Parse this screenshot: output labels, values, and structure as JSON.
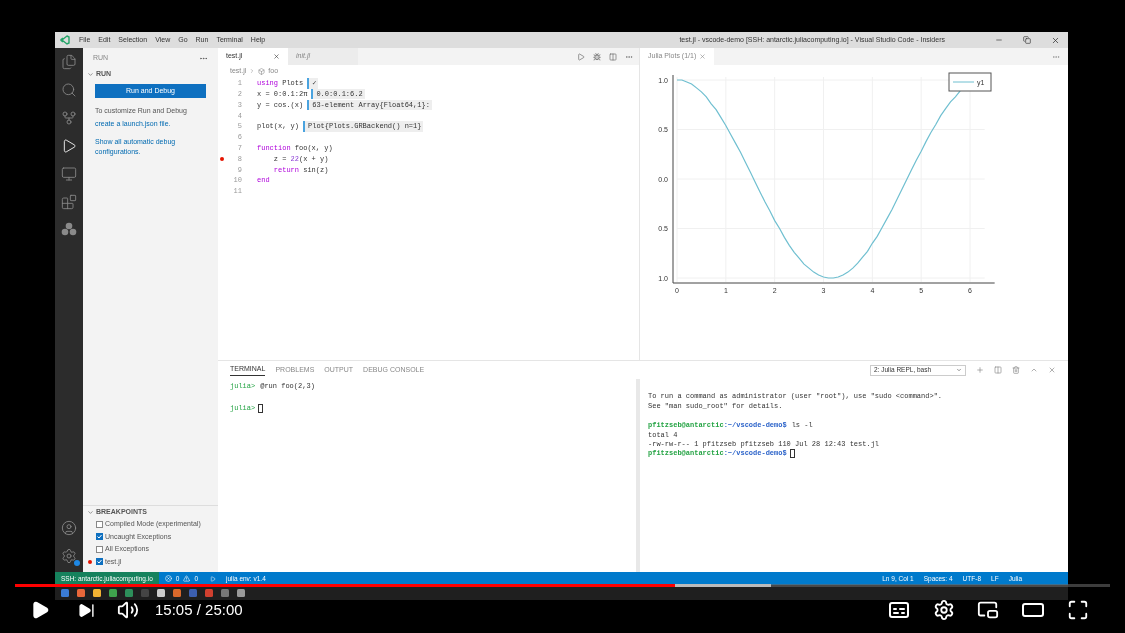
{
  "window": {
    "menu": [
      "File",
      "Edit",
      "Selection",
      "View",
      "Go",
      "Run",
      "Terminal",
      "Help"
    ],
    "title": "test.jl - vscode-demo [SSH: antarctic.juliacomputing.io] - Visual Studio Code - Insiders"
  },
  "sidebar": {
    "header": "RUN",
    "section": "RUN",
    "button": "Run and Debug",
    "hint": "To customize Run and Debug",
    "link": "create a launch.json file.",
    "show_all": "Show all automatic debug configurations.",
    "breakpoints": {
      "title": "BREAKPOINTS",
      "items": [
        {
          "label": "Compiled Mode (experimental)",
          "checked": false,
          "breakpoint": false
        },
        {
          "label": "Uncaught Exceptions",
          "checked": true,
          "breakpoint": false
        },
        {
          "label": "All Exceptions",
          "checked": false,
          "breakpoint": false
        },
        {
          "label": "test.jl",
          "checked": true,
          "breakpoint": true
        }
      ]
    }
  },
  "editor": {
    "tabs": [
      {
        "label": "test.jl",
        "selected": true
      },
      {
        "label": "init.jl",
        "selected": false
      }
    ],
    "breadcrumb": [
      "test.jl",
      "foo"
    ],
    "lines": [
      {
        "num": "1",
        "breakpoint": false,
        "tokens": [
          {
            "text": "using",
            "kind": "kw"
          },
          {
            "text": " Plots",
            "kind": "plain"
          }
        ],
        "result": "✓"
      },
      {
        "num": "2",
        "breakpoint": false,
        "tokens": [
          {
            "text": "x = 0:0.1:2π",
            "kind": "plain"
          }
        ],
        "result": "0.0:0.1:6.2"
      },
      {
        "num": "3",
        "breakpoint": false,
        "tokens": [
          {
            "text": "y = cos.(x)",
            "kind": "plain"
          }
        ],
        "result": "63-element Array{Float64,1}:"
      },
      {
        "num": "4",
        "breakpoint": false
      },
      {
        "num": "5",
        "breakpoint": false,
        "tokens": [
          {
            "text": "plot(x, y)",
            "kind": "plain"
          }
        ],
        "result": "Plot{Plots.GRBackend() n=1}"
      },
      {
        "num": "6",
        "breakpoint": false
      },
      {
        "num": "7",
        "breakpoint": false,
        "tokens": [
          {
            "text": "function",
            "kind": "kw"
          },
          {
            "text": " foo(x, y)",
            "kind": "plain"
          }
        ]
      },
      {
        "num": "8",
        "breakpoint": true,
        "tokens": [
          {
            "text": "    z = ",
            "kind": "plain"
          },
          {
            "text": "22",
            "kind": "num"
          },
          {
            "text": "(x + y)",
            "kind": "plain"
          }
        ]
      },
      {
        "num": "9",
        "breakpoint": false,
        "tokens": [
          {
            "text": "    return",
            "kind": "kw"
          },
          {
            "text": " sin(z)",
            "kind": "plain"
          }
        ]
      },
      {
        "num": "10",
        "breakpoint": false,
        "tokens": [
          {
            "text": "end",
            "kind": "kw"
          }
        ]
      },
      {
        "num": "11",
        "breakpoint": false
      }
    ]
  },
  "plot_pane": {
    "tab": "Julia Plots (1/1)",
    "chart_data": {
      "type": "line",
      "x": [
        0,
        0.1,
        0.2,
        0.3,
        0.4,
        0.5,
        0.6,
        0.7,
        0.8,
        0.9,
        1,
        1.1,
        1.2,
        1.3,
        1.4,
        1.5,
        1.6,
        1.7,
        1.8,
        1.9,
        2,
        2.1,
        2.2,
        2.3,
        2.4,
        2.5,
        2.6,
        2.7,
        2.8,
        2.9,
        3,
        3.1,
        3.2,
        3.3,
        3.4,
        3.5,
        3.6,
        3.7,
        3.8,
        3.9,
        4,
        4.1,
        4.2,
        4.3,
        4.4,
        4.5,
        4.6,
        4.7,
        4.8,
        4.9,
        5,
        5.1,
        5.2,
        5.3,
        5.4,
        5.5,
        5.6,
        5.7,
        5.8
      ],
      "series": [
        {
          "name": "y1",
          "color": "#6fbfd0",
          "values": [
            1,
            1,
            0.98,
            0.96,
            0.92,
            0.88,
            0.83,
            0.76,
            0.7,
            0.62,
            0.54,
            0.45,
            0.36,
            0.27,
            0.17,
            0.07,
            -0.03,
            -0.13,
            -0.23,
            -0.32,
            -0.42,
            -0.5,
            -0.59,
            -0.67,
            -0.74,
            -0.8,
            -0.86,
            -0.9,
            -0.94,
            -0.97,
            -0.99,
            -1,
            -1,
            -0.99,
            -0.97,
            -0.94,
            -0.9,
            -0.85,
            -0.79,
            -0.73,
            -0.65,
            -0.58,
            -0.49,
            -0.4,
            -0.31,
            -0.21,
            -0.11,
            -0.01,
            0.09,
            0.19,
            0.28,
            0.38,
            0.47,
            0.55,
            0.64,
            0.71,
            0.78,
            0.83,
            0.89
          ]
        }
      ],
      "grid": true,
      "xlim": [
        0,
        6.3
      ],
      "ylim": [
        -1,
        1
      ],
      "xticks": [
        0,
        1,
        2,
        3,
        4,
        5,
        6
      ],
      "yticks": [
        {
          "value": 1,
          "label": "1.0"
        },
        {
          "value": 0.5,
          "label": "0.5"
        },
        {
          "value": 0,
          "label": "0.0"
        },
        {
          "value": -0.5,
          "label": "0.5"
        },
        {
          "value": -1,
          "label": "1.0"
        }
      ]
    }
  },
  "panel": {
    "tabs": [
      {
        "label": "TERMINAL",
        "selected": true
      },
      {
        "label": "PROBLEMS",
        "selected": false
      },
      {
        "label": "OUTPUT",
        "selected": false
      },
      {
        "label": "DEBUG CONSOLE",
        "selected": false
      }
    ],
    "terminal_select": "2: Julia REPL, bash",
    "left_blocks": [
      [
        {
          "prompt": "julia>",
          "text": "@run foo(2,3)",
          "cursor": false
        }
      ],
      [
        {
          "prompt": "julia>",
          "cursor": true
        }
      ]
    ],
    "right_blocks": [
      [
        {
          "kind": "output",
          "text": "To run a command as administrator (user \"root\"), use \"sudo <command>\"."
        },
        {
          "kind": "output",
          "text": "See \"man sudo_root\" for details."
        }
      ],
      [
        {
          "kind": "prompt",
          "user": "pfitzseb@antarctic",
          "path": ":~/vscode-demo$",
          "text": "ls -l",
          "cursor": false
        },
        {
          "kind": "output",
          "text": "total 4"
        },
        {
          "kind": "output",
          "text": "-rw-rw-r-- 1 pfitzseb pfitzseb 110 Jul 28 12:43 test.jl"
        },
        {
          "kind": "prompt",
          "user": "pfitzseb@antarctic",
          "path": ":~/vscode-demo$",
          "cursor": true
        }
      ]
    ]
  },
  "status_bar": {
    "remote": "SSH: antarctic.juliacomputing.io",
    "errors": "0",
    "warnings": "0",
    "env": "julia env: v1.4",
    "right": [
      "Ln 9, Col 1",
      "Spaces: 4",
      "UTF-8",
      "LF",
      "Julia"
    ]
  },
  "player": {
    "progress": {
      "level": 0.603
    },
    "buffer": {
      "level": 0.69
    },
    "time": "15:05 / 25:00"
  }
}
